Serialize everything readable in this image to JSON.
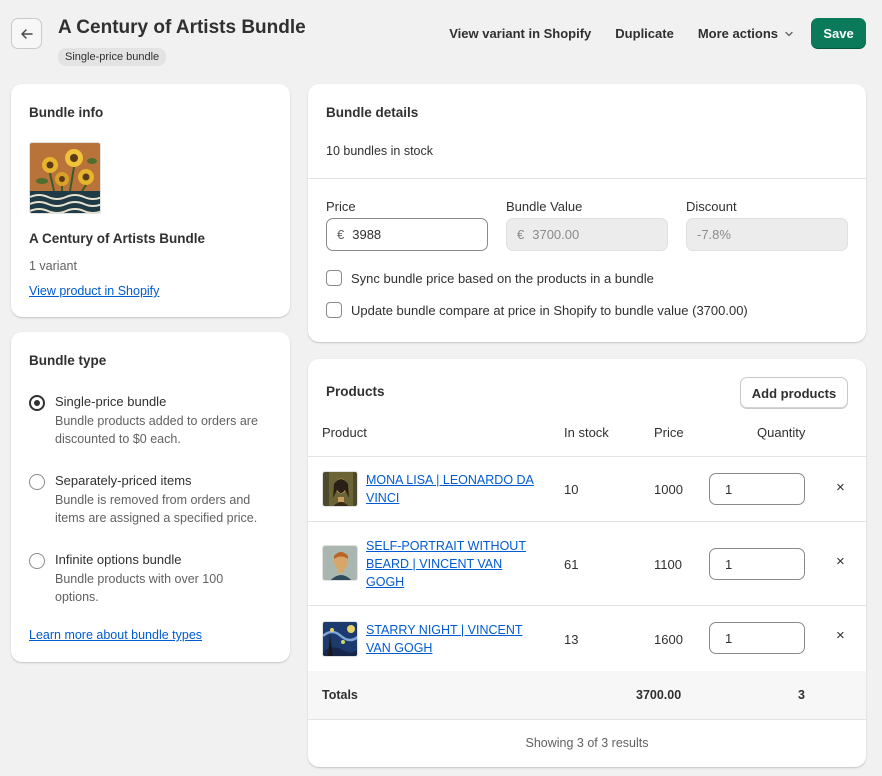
{
  "header": {
    "title": "A Century of Artists Bundle",
    "badge": "Single-price bundle",
    "actions": {
      "view_variant": "View variant in Shopify",
      "duplicate": "Duplicate",
      "more_actions": "More actions",
      "save": "Save"
    }
  },
  "bundle_info": {
    "title": "Bundle info",
    "name": "A Century of Artists Bundle",
    "variants": "1 variant",
    "view_link": "View product in Shopify"
  },
  "bundle_type": {
    "title": "Bundle type",
    "options": [
      {
        "label": "Single-price bundle",
        "desc": "Bundle products added to orders are discounted to $0 each.",
        "checked": true
      },
      {
        "label": "Separately-priced items",
        "desc": "Bundle is removed from orders and items are assigned a specified price.",
        "checked": false
      },
      {
        "label": "Infinite options bundle",
        "desc": "Bundle products with over 100 options.",
        "checked": false
      }
    ],
    "learn_more": "Learn more about bundle types"
  },
  "bundle_details": {
    "title": "Bundle details",
    "stock": "10 bundles in stock",
    "price_label": "Price",
    "price_prefix": "€",
    "price_value": "3988",
    "bundle_value_label": "Bundle Value",
    "bundle_value_prefix": "€",
    "bundle_value_placeholder": "3700.00",
    "discount_label": "Discount",
    "discount_placeholder": "-7.8%",
    "sync_label": "Sync bundle price based on the products in a bundle",
    "update_label": "Update bundle compare at price in Shopify to bundle value (3700.00)"
  },
  "products": {
    "title": "Products",
    "add_button": "Add products",
    "columns": {
      "product": "Product",
      "in_stock": "In stock",
      "price": "Price",
      "quantity": "Quantity"
    },
    "rows": [
      {
        "name": "MONA LISA | LEONARDO DA VINCI",
        "in_stock": "10",
        "price": "1000",
        "quantity": "1"
      },
      {
        "name": "SELF-PORTRAIT WITHOUT BEARD | VINCENT VAN GOGH",
        "in_stock": "61",
        "price": "1100",
        "quantity": "1"
      },
      {
        "name": "STARRY NIGHT | VINCENT VAN GOGH",
        "in_stock": "13",
        "price": "1600",
        "quantity": "1"
      }
    ],
    "totals_label": "Totals",
    "totals_price": "3700.00",
    "totals_quantity": "3",
    "footer": "Showing 3 of 3 results"
  },
  "colors": {
    "accent": "#0b7a5a",
    "link": "#005bd3",
    "background": "#f1f1f1"
  }
}
